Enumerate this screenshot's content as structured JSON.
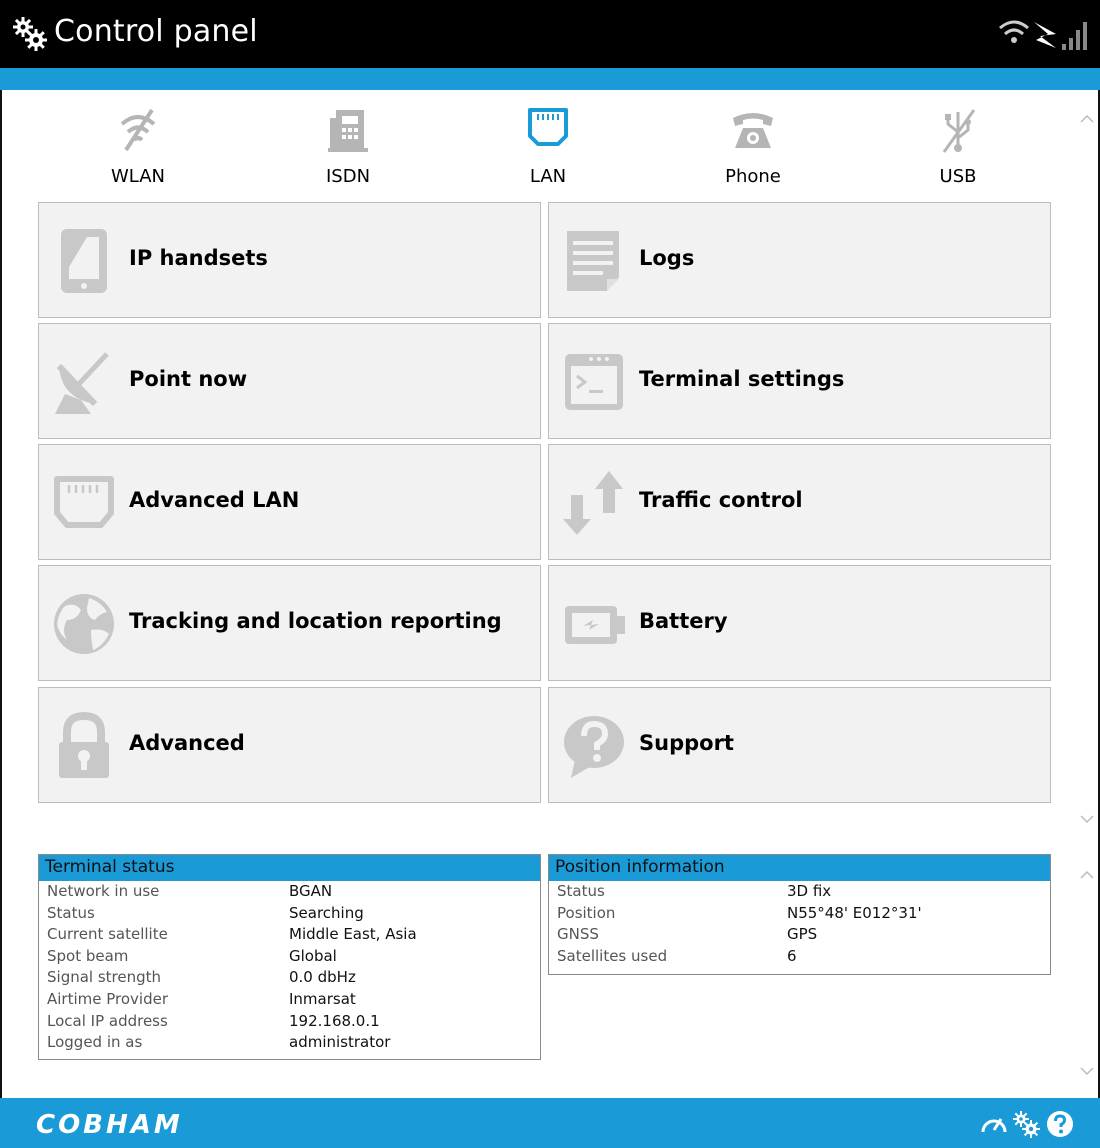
{
  "header": {
    "title": "Control panel"
  },
  "tabs": [
    {
      "label": "WLAN",
      "icon": "wifi-off-icon",
      "active": false
    },
    {
      "label": "ISDN",
      "icon": "isdn-phone-icon",
      "active": false
    },
    {
      "label": "LAN",
      "icon": "lan-port-icon",
      "active": true
    },
    {
      "label": "Phone",
      "icon": "phone-icon",
      "active": false
    },
    {
      "label": "USB",
      "icon": "usb-off-icon",
      "active": false
    }
  ],
  "tiles": [
    {
      "label": "IP handsets",
      "icon": "ip-handset-icon"
    },
    {
      "label": "Logs",
      "icon": "logs-icon"
    },
    {
      "label": "Point now",
      "icon": "satellite-dish-icon"
    },
    {
      "label": "Terminal settings",
      "icon": "terminal-icon"
    },
    {
      "label": "Advanced LAN",
      "icon": "lan-port-icon"
    },
    {
      "label": "Traffic control",
      "icon": "traffic-arrows-icon"
    },
    {
      "label": "Tracking and location reporting",
      "icon": "globe-icon"
    },
    {
      "label": "Battery",
      "icon": "battery-icon"
    },
    {
      "label": "Advanced",
      "icon": "padlock-icon"
    },
    {
      "label": "Support",
      "icon": "help-bubble-icon"
    }
  ],
  "terminal_status": {
    "title": "Terminal status",
    "rows": [
      {
        "key": "Network in use",
        "value": "BGAN"
      },
      {
        "key": "Status",
        "value": "Searching"
      },
      {
        "key": "Current satellite",
        "value": "Middle East, Asia"
      },
      {
        "key": "Spot beam",
        "value": "Global"
      },
      {
        "key": "Signal strength",
        "value": "0.0 dbHz"
      },
      {
        "key": "Airtime Provider",
        "value": "Inmarsat"
      },
      {
        "key": "Local IP address",
        "value": "192.168.0.1"
      },
      {
        "key": "Logged in as",
        "value": "administrator"
      }
    ]
  },
  "position_info": {
    "title": "Position information",
    "rows": [
      {
        "key": "Status",
        "value": "3D fix"
      },
      {
        "key": "Position",
        "value": "N55°48' E012°31'"
      },
      {
        "key": "GNSS",
        "value": "GPS"
      },
      {
        "key": "Satellites used",
        "value": "6"
      }
    ]
  },
  "footer": {
    "brand": "COBHAM"
  },
  "colors": {
    "accent": "#1a9bd7",
    "active_tab": "#1a9bd7",
    "icon_gray": "#b5b5b5",
    "tile_bg": "#f2f2f2"
  }
}
